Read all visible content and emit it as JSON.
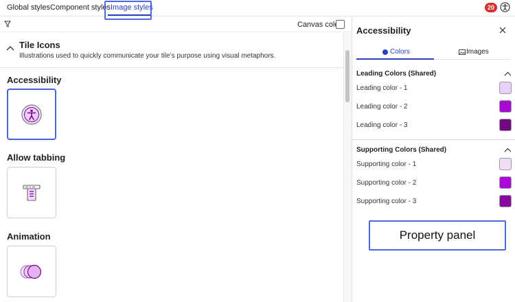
{
  "tabs": {
    "global": "Global styles",
    "component": "Component styles",
    "image": "Image styles",
    "active": "Image styles"
  },
  "notifications": {
    "count": "20"
  },
  "canvas": {
    "canvas_color_label": "Canvas color",
    "section_title": "Tile Icons",
    "section_description": "Illustrations used to quickly communicate your tile’s purpose using visual metaphors.",
    "icons": [
      {
        "label": "Accessibility",
        "icon": "accessibility-icon",
        "selected": true
      },
      {
        "label": "Allow tabbing",
        "icon": "allow-tabbing-icon",
        "selected": false
      },
      {
        "label": "Animation",
        "icon": "animation-icon",
        "selected": false
      }
    ]
  },
  "panel": {
    "title": "Accessibility",
    "tabs": {
      "colors": "Colors",
      "images": "Images",
      "active": "Colors"
    },
    "groups": [
      {
        "title": "Leading Colors (Shared)",
        "colors": [
          {
            "label": "Leading color - 1",
            "value": "#ead0f8"
          },
          {
            "label": "Leading color - 2",
            "value": "#a80ad6"
          },
          {
            "label": "Leading color - 3",
            "value": "#72087f"
          }
        ]
      },
      {
        "title": "Supporting Colors (Shared)",
        "colors": [
          {
            "label": "Supporting color - 1",
            "value": "#f1def8"
          },
          {
            "label": "Supporting color - 2",
            "value": "#ad0ad9"
          },
          {
            "label": "Supporting color - 3",
            "value": "#8a0a9f"
          }
        ]
      }
    ]
  },
  "callouts": {
    "property_panel": "Property panel"
  },
  "colors": {
    "accent": "#2b3fc4",
    "highlight": "#4a6bdf",
    "badge": "#d63030"
  }
}
